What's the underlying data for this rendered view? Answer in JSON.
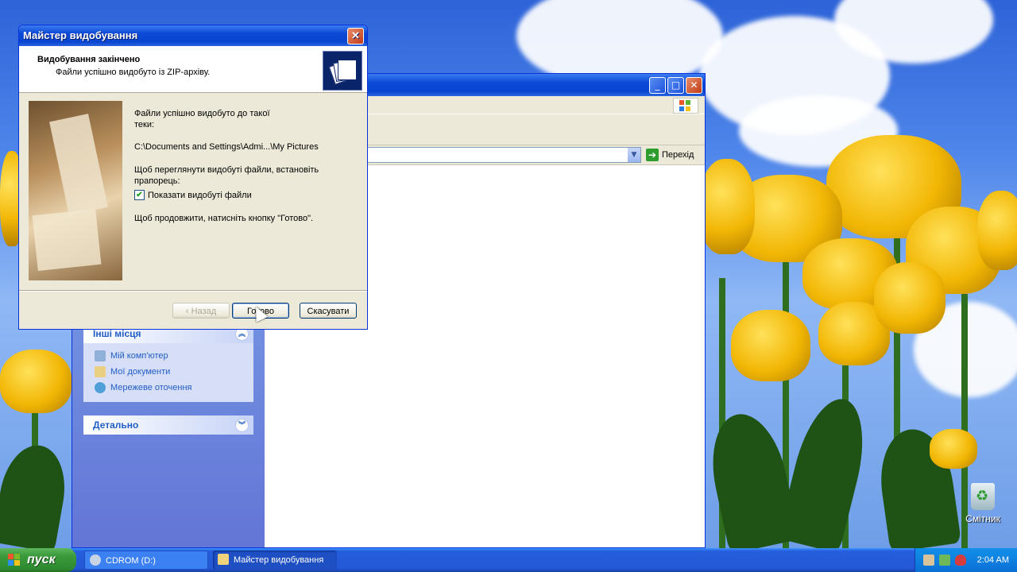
{
  "wizard": {
    "title": "Майстер видобування",
    "header_title": "Видобування закінчено",
    "header_subtitle": "Файли успішно видобуто із ZIP-архіву.",
    "line1": "Файли успішно видобуто до такої",
    "line2": "теки:",
    "path": "C:\\Documents and Settings\\Admi...\\My Pictures",
    "instruction1": "Щоб переглянути видобуті файли, встановіть",
    "instruction2": "прапорець:",
    "checkbox_label": "Показати видобуті файли",
    "checkbox_checked": true,
    "continue_text": "Щоб продовжити, натисніть кнопку \"Готово\".",
    "back_label": "‹ Назад",
    "finish_label": "Готово",
    "cancel_label": "Скасувати"
  },
  "explorer": {
    "go_label": "Перехід",
    "other_places": {
      "title": "Інші місця",
      "items": [
        "Мій комп'ютер",
        "Мої документи",
        "Мережеве оточення"
      ]
    },
    "details_title": "Детально"
  },
  "desktop": {
    "recycle_bin": "Смітник"
  },
  "taskbar": {
    "start_label": "пуск",
    "tasks": [
      "CDROM (D:)",
      "Майстер видобування"
    ],
    "clock": "2:04 AM"
  }
}
